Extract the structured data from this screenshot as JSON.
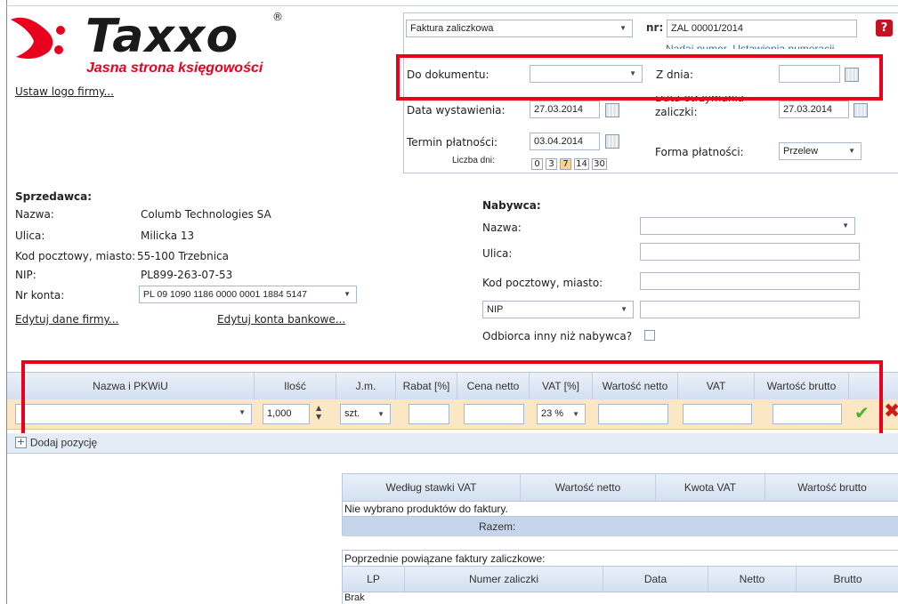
{
  "logo": {
    "brand": "Taxxo",
    "registered": "®",
    "tagline": "Jasna strona księgowości",
    "set_logo_link": "Ustaw logo firmy..."
  },
  "header": {
    "doc_type": "Faktura zaliczkowa",
    "nr_label": "nr:",
    "nr_value": "ZAL 00001/2014",
    "numbering_links": "Nadaj numer  Ustawienia numeracji",
    "do_dokumentu_label": "Do dokumentu:",
    "do_dokumentu_value": "",
    "z_dnia_label": "Z dnia:",
    "z_dnia_value": "",
    "data_wystawienia_label": "Data wystawienia:",
    "data_wystawienia_value": "27.03.2014",
    "data_otrzymania_label_1": "Data otrzymania",
    "data_otrzymania_label_2": "zaliczki:",
    "data_otrzymania_value": "27.03.2014",
    "termin_label": "Termin płatności:",
    "termin_value": "03.04.2014",
    "liczba_dni_label": "Liczba dni:",
    "liczba_dni_options": [
      "0",
      "3",
      "7",
      "14",
      "30"
    ],
    "forma_label": "Forma płatności:",
    "forma_value": "Przelew"
  },
  "seller": {
    "title": "Sprzedawca:",
    "nazwa_label": "Nazwa:",
    "nazwa_value": "Columb Technologies SA",
    "ulica_label": "Ulica:",
    "ulica_value": "Milicka 13",
    "kod_label": "Kod pocztowy, miasto:",
    "kod_value": "55-100 Trzebnica",
    "nip_label": "NIP:",
    "nip_value": "PL899-263-07-53",
    "konto_label": "Nr konta:",
    "konto_value": "PL 09 1090 1186 0000 0001 1884 5147",
    "edit_company_link": "Edytuj dane firmy...",
    "edit_accounts_link": "Edytuj konta bankowe..."
  },
  "buyer": {
    "title": "Nabywca:",
    "nazwa_label": "Nazwa:",
    "ulica_label": "Ulica:",
    "kod_label": "Kod pocztowy, miasto:",
    "nip_select": "NIP",
    "odbiorca_label": "Odbiorca inny niż nabywca?"
  },
  "items_table": {
    "columns": [
      "Nazwa i PKWiU",
      "Ilość",
      "J.m.",
      "Rabat [%]",
      "Cena netto",
      "VAT [%]",
      "Wartość netto",
      "VAT",
      "Wartość brutto"
    ],
    "row": {
      "ilosc": "1,000",
      "jm": "szt.",
      "vat": "23 %"
    },
    "add_position": "Dodaj pozycję"
  },
  "vat_summary": {
    "columns": [
      "Według stawki VAT",
      "Wartość netto",
      "Kwota VAT",
      "Wartość brutto"
    ],
    "empty_text": "Nie wybrano produktów do faktury.",
    "total_label": "Razem:"
  },
  "prior_advances": {
    "title": "Poprzednie powiązane faktury zaliczkowe:",
    "columns": [
      "LP",
      "Numer zaliczki",
      "Data",
      "Netto",
      "Brutto"
    ],
    "empty_text": "Brak"
  },
  "colors": {
    "accent_red": "#e8001c",
    "header_blue": "#dbe6f4",
    "row_highlight": "#fbe7c4"
  }
}
